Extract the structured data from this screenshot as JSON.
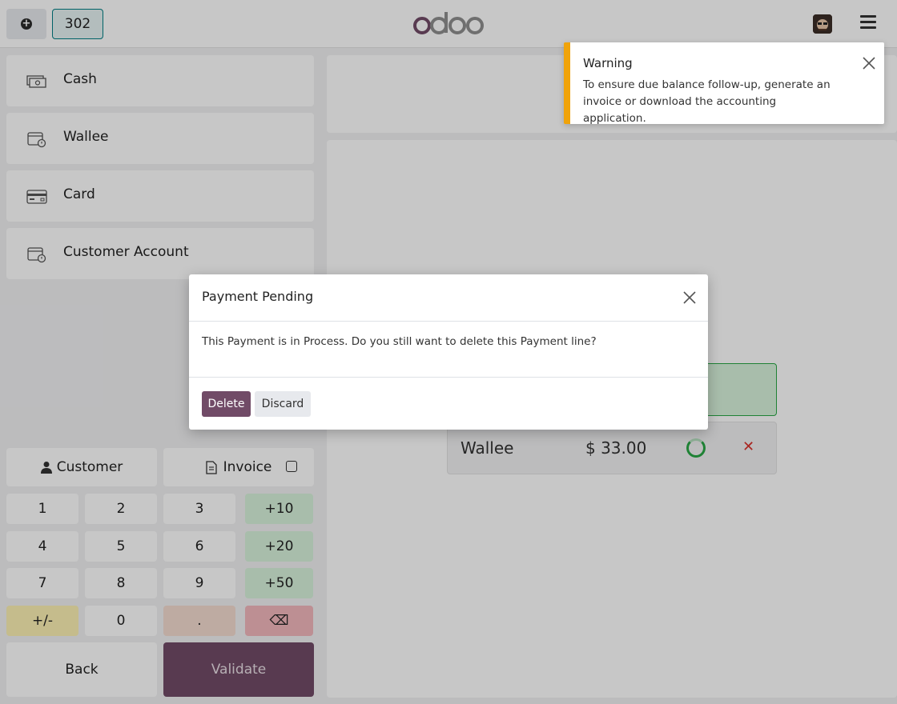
{
  "header": {
    "new_order_icon": "plus-circle-icon",
    "order_number": "302",
    "logo_text": "odoo",
    "menu_icon": "hamburger-icon"
  },
  "payment_methods": [
    {
      "label": "Cash",
      "icon": "cash-icon"
    },
    {
      "label": "Wallee",
      "icon": "wallet-clock-icon"
    },
    {
      "label": "Card",
      "icon": "credit-card-icon"
    },
    {
      "label": "Customer Account",
      "icon": "wallet-clock-icon"
    }
  ],
  "controls": {
    "customer_label": "Customer",
    "invoice_label": "Invoice"
  },
  "numpad": {
    "row1": [
      "1",
      "2",
      "3",
      "+10"
    ],
    "row2": [
      "4",
      "5",
      "6",
      "+20"
    ],
    "row3": [
      "7",
      "8",
      "9",
      "+50"
    ],
    "row4": [
      "+/-",
      "0",
      ".",
      "⌫"
    ]
  },
  "footer": {
    "back_label": "Back",
    "validate_label": "Validate"
  },
  "payment_lines": [
    {
      "name": "Wallee",
      "amount": "$ 33.00",
      "status": "pending"
    }
  ],
  "toast": {
    "title": "Warning",
    "message": "To ensure due balance follow-up, generate an invoice or download the accounting application."
  },
  "dialog": {
    "title": "Payment Pending",
    "body": "This Payment is in Process. Do you still want to delete this Payment line?",
    "delete_label": "Delete",
    "discard_label": "Discard"
  },
  "colors": {
    "brand": "#714b67",
    "teal": "#017e84",
    "warning": "#f0a30a",
    "success": "#28a745",
    "danger": "#d9312b"
  }
}
